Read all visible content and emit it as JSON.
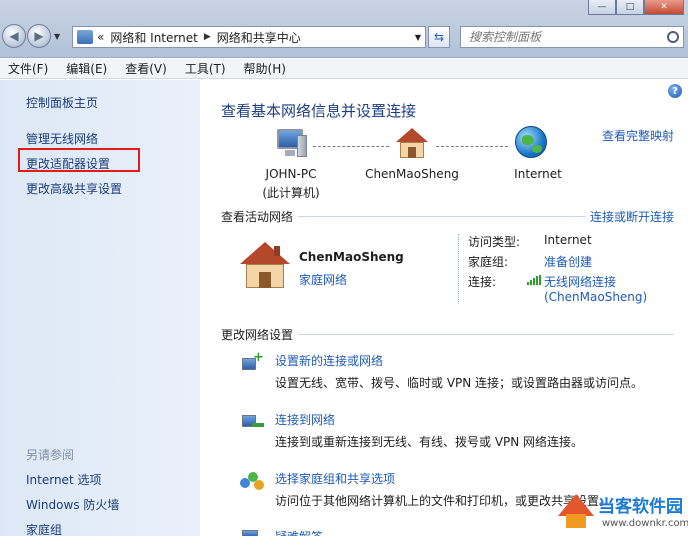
{
  "window": {
    "controls": {
      "minimize": "—",
      "maximize": "□",
      "close": "✕"
    }
  },
  "address": {
    "prefix": "«",
    "segments": [
      "网络和 Internet",
      "网络和共享中心"
    ],
    "search_placeholder": "搜索控制面板"
  },
  "menu": [
    "文件(F)",
    "编辑(E)",
    "查看(V)",
    "工具(T)",
    "帮助(H)"
  ],
  "sidebar": {
    "items": [
      "控制面板主页",
      "管理无线网络",
      "更改适配器设置",
      "更改高级共享设置"
    ],
    "see_also_label": "另请参阅",
    "see_also": [
      "Internet 选项",
      "Windows 防火墙",
      "家庭组"
    ]
  },
  "main": {
    "title": "查看基本网络信息并设置连接",
    "map_link": "查看完整映射",
    "nodes": {
      "pc_name": "JOHN-PC",
      "pc_sub": "(此计算机)",
      "network": "ChenMaoSheng",
      "internet": "Internet"
    },
    "active": {
      "heading": "查看活动网络",
      "connect_link": "连接或断开连接",
      "name": "ChenMaoSheng",
      "type": "家庭网络",
      "access_label": "访问类型:",
      "access_value": "Internet",
      "homegroup_label": "家庭组:",
      "homegroup_value": "准备创建",
      "conn_label": "连接:",
      "conn_value": "无线网络连接",
      "conn_value2": "(ChenMaoSheng)"
    },
    "change": {
      "heading": "更改网络设置",
      "tasks": [
        {
          "title": "设置新的连接或网络",
          "desc": "设置无线、宽带、拨号、临时或 VPN 连接；或设置路由器或访问点。"
        },
        {
          "title": "连接到网络",
          "desc": "连接到或重新连接到无线、有线、拨号或 VPN 网络连接。"
        },
        {
          "title": "选择家庭组和共享选项",
          "desc": "访问位于其他网络计算机上的文件和打印机，或更改共享设置。"
        },
        {
          "title": "疑难解答"
        }
      ]
    }
  },
  "watermark": {
    "name": "当客软件园",
    "url": "www.downkr.com"
  },
  "colors": {
    "link": "#1d5bb6",
    "highlight": "#e31b1b",
    "sidebar": "#dde8f6"
  },
  "icons": [
    "back-icon",
    "forward-icon",
    "refresh-icon",
    "search-icon",
    "help-icon",
    "computer-icon",
    "house-icon",
    "globe-icon",
    "signal-icon",
    "task-icons"
  ]
}
